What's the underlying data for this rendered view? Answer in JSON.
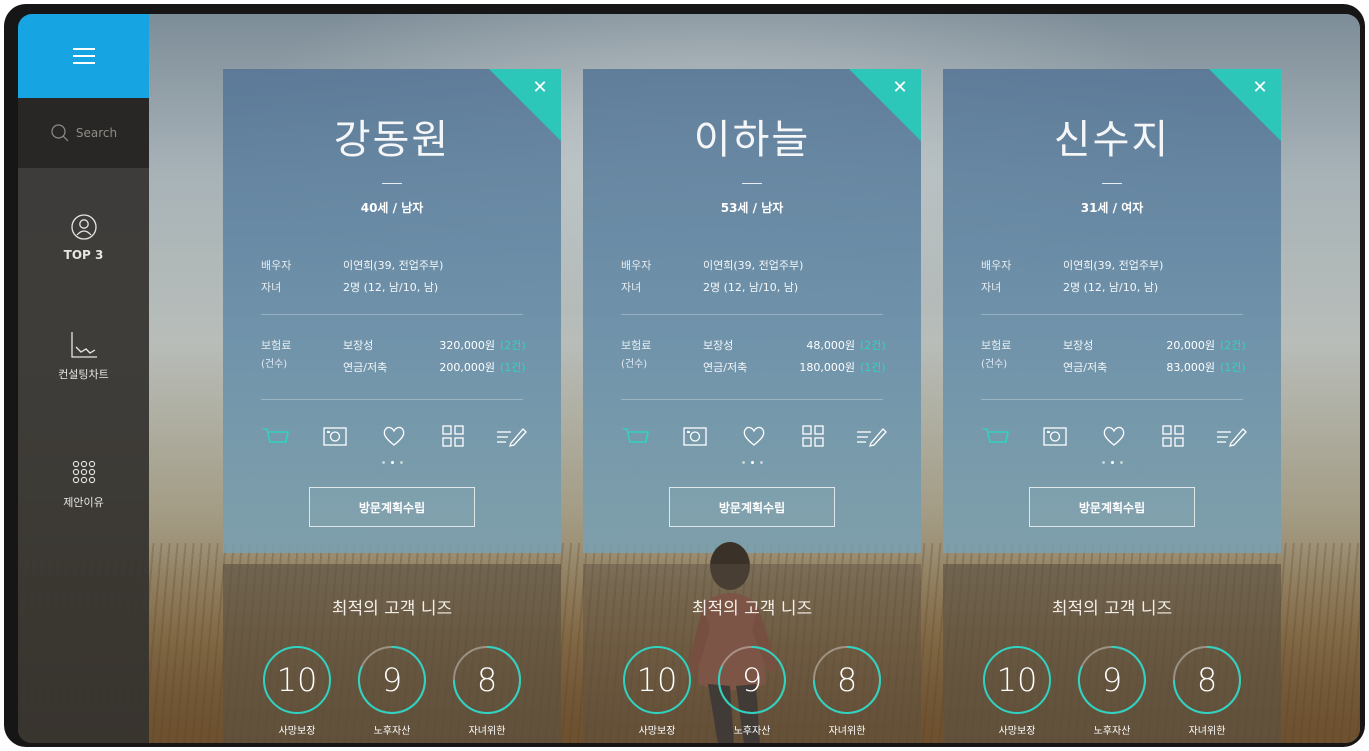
{
  "sidebar": {
    "search_label": "Search",
    "items": [
      {
        "label": "TOP 3",
        "icon": "user-circle-icon"
      },
      {
        "label": "컨설팅차트",
        "icon": "line-chart-icon"
      },
      {
        "label": "제안이유",
        "icon": "dots-grid-icon"
      }
    ]
  },
  "colors": {
    "accent": "#2cc7b9",
    "menu_blue": "#16a4e3",
    "count_cyan": "#2fd3c2"
  },
  "cards": [
    {
      "name": "강동원",
      "age_gender": "40세 / 남자",
      "spouse_label": "배우자",
      "spouse_value": "이연희(39, 전업주부)",
      "children_label": "자녀",
      "children_value": "2명 (12, 남/10, 남)",
      "premium_label": "보험료",
      "premium_sub": "(건수)",
      "protection_label": "보장성",
      "protection_amount": "320,000원",
      "protection_count": "(2건)",
      "pension_label": "연금/저축",
      "pension_amount": "200,000원",
      "pension_count": "(1건)",
      "visit_button": "방문계획수립"
    },
    {
      "name": "이하늘",
      "age_gender": "53세 / 남자",
      "spouse_label": "배우자",
      "spouse_value": "이연희(39, 전업주부)",
      "children_label": "자녀",
      "children_value": "2명 (12, 남/10, 남)",
      "premium_label": "보험료",
      "premium_sub": "(건수)",
      "protection_label": "보장성",
      "protection_amount": "48,000원",
      "protection_count": "(2건)",
      "pension_label": "연금/저축",
      "pension_amount": "180,000원",
      "pension_count": "(1건)",
      "visit_button": "방문계획수립"
    },
    {
      "name": "신수지",
      "age_gender": "31세 / 여자",
      "spouse_label": "배우자",
      "spouse_value": "이연희(39, 전업주부)",
      "children_label": "자녀",
      "children_value": "2명 (12, 남/10, 남)",
      "premium_label": "보험료",
      "premium_sub": "(건수)",
      "protection_label": "보장성",
      "protection_amount": "20,000원",
      "protection_count": "(2건)",
      "pension_label": "연금/저축",
      "pension_amount": "83,000원",
      "pension_count": "(1건)",
      "visit_button": "방문계획수립"
    }
  ],
  "needs": {
    "title": "최적의 고객 니즈",
    "scores": [
      {
        "value": "10",
        "label": "사망보장"
      },
      {
        "value": "9",
        "label": "노후자산"
      },
      {
        "value": "8",
        "label": "자녀위한"
      }
    ]
  }
}
